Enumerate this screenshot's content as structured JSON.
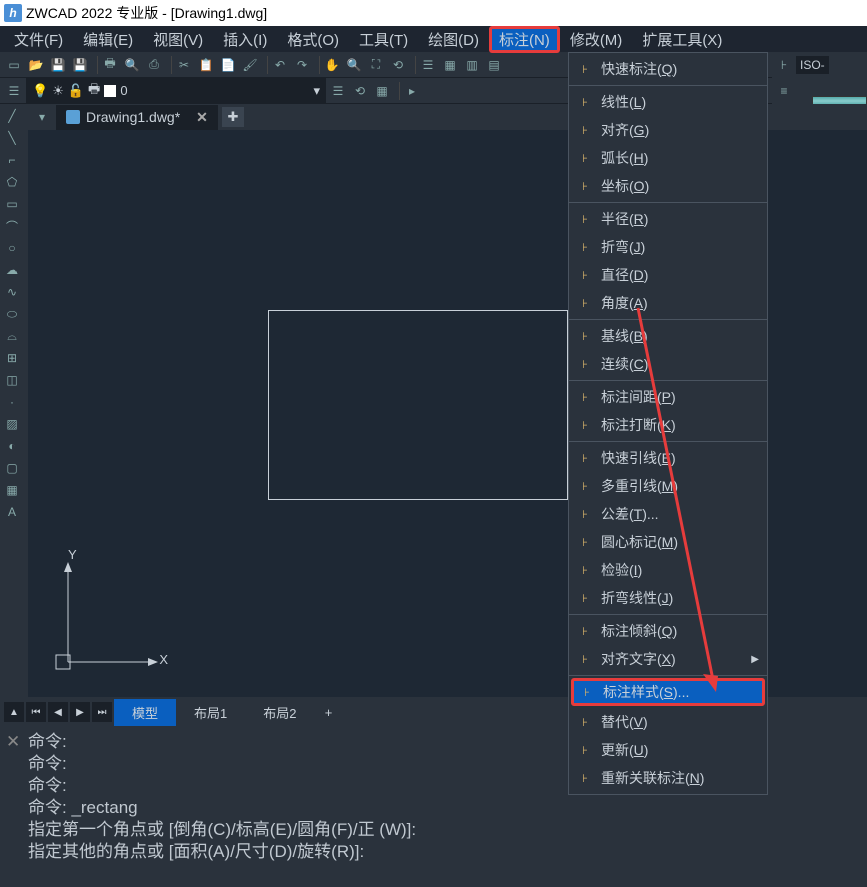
{
  "title": "ZWCAD 2022 专业版 - [Drawing1.dwg]",
  "logo_text": "h",
  "menubar": [
    {
      "label": "文件(F)"
    },
    {
      "label": "编辑(E)"
    },
    {
      "label": "视图(V)"
    },
    {
      "label": "插入(I)"
    },
    {
      "label": "格式(O)"
    },
    {
      "label": "工具(T)"
    },
    {
      "label": "绘图(D)"
    },
    {
      "label": "标注(N)",
      "active": true
    },
    {
      "label": "修改(M)"
    },
    {
      "label": "扩展工具(X)"
    }
  ],
  "layer_name": "0",
  "iso_label": "ISO-",
  "doc_tab": "Drawing1.dwg*",
  "ucs": {
    "y": "Y",
    "x": "X"
  },
  "bottom_tabs": {
    "tabs": [
      {
        "label": "模型",
        "active": true
      },
      {
        "label": "布局1"
      },
      {
        "label": "布局2"
      }
    ],
    "add": "+"
  },
  "command_lines": [
    "命令:",
    "命令:",
    "命令:",
    "命令: _rectang",
    "指定第一个角点或 [倒角(C)/标高(E)/圆角(F)/正         (W)]:",
    "指定其他的角点或 [面积(A)/尺寸(D)/旋转(R)]:"
  ],
  "dropdown": [
    {
      "label": "快速标注(Q)",
      "sep": true
    },
    {
      "label": "线性(L)"
    },
    {
      "label": "对齐(G)"
    },
    {
      "label": "弧长(H)"
    },
    {
      "label": "坐标(O)",
      "sep": true
    },
    {
      "label": "半径(R)"
    },
    {
      "label": "折弯(J)"
    },
    {
      "label": "直径(D)"
    },
    {
      "label": "角度(A)",
      "sep": true
    },
    {
      "label": "基线(B)"
    },
    {
      "label": "连续(C)",
      "sep": true
    },
    {
      "label": "标注间距(P)"
    },
    {
      "label": "标注打断(K)",
      "sep": true
    },
    {
      "label": "快速引线(E)"
    },
    {
      "label": "多重引线(M)"
    },
    {
      "label": "公差(T)..."
    },
    {
      "label": "圆心标记(M)"
    },
    {
      "label": "检验(I)"
    },
    {
      "label": "折弯线性(J)",
      "sep": true
    },
    {
      "label": "标注倾斜(Q)"
    },
    {
      "label": "对齐文字(X)",
      "submenu": true,
      "sep": true
    },
    {
      "label": "标注样式(S)...",
      "highlighted": true
    },
    {
      "label": "替代(V)"
    },
    {
      "label": "更新(U)"
    },
    {
      "label": "重新关联标注(N)"
    }
  ]
}
